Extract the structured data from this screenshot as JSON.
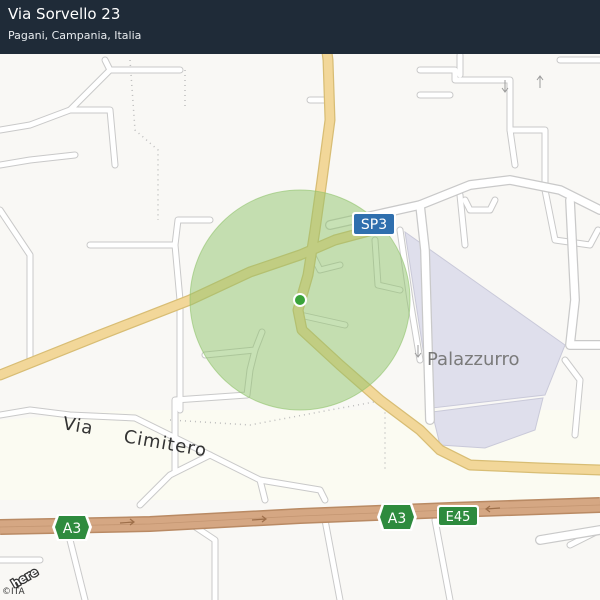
{
  "location": {
    "address": "Via Sorvello 23",
    "region": "Pagani, Campania, Italia"
  },
  "labels": {
    "street_name_1": "Via",
    "street_name_2": "Cimitero",
    "place": "Palazzurro"
  },
  "shields": {
    "sp3": "SP3",
    "a3_left": "A3",
    "a3_right": "A3",
    "e45": "E45"
  },
  "branding": {
    "logo_text": "here",
    "credit": "©ITA"
  },
  "colors": {
    "header_bg": "#1f2b38",
    "accuracy_circle": "#8fc36b",
    "location_dot": "#3aa33a",
    "main_road": "#f2d799",
    "motorway": "#d5a783",
    "industrial_area": "#dfdfec",
    "shield_sp": "#2f6fae",
    "shield_motorway": "#2e8b3e"
  }
}
